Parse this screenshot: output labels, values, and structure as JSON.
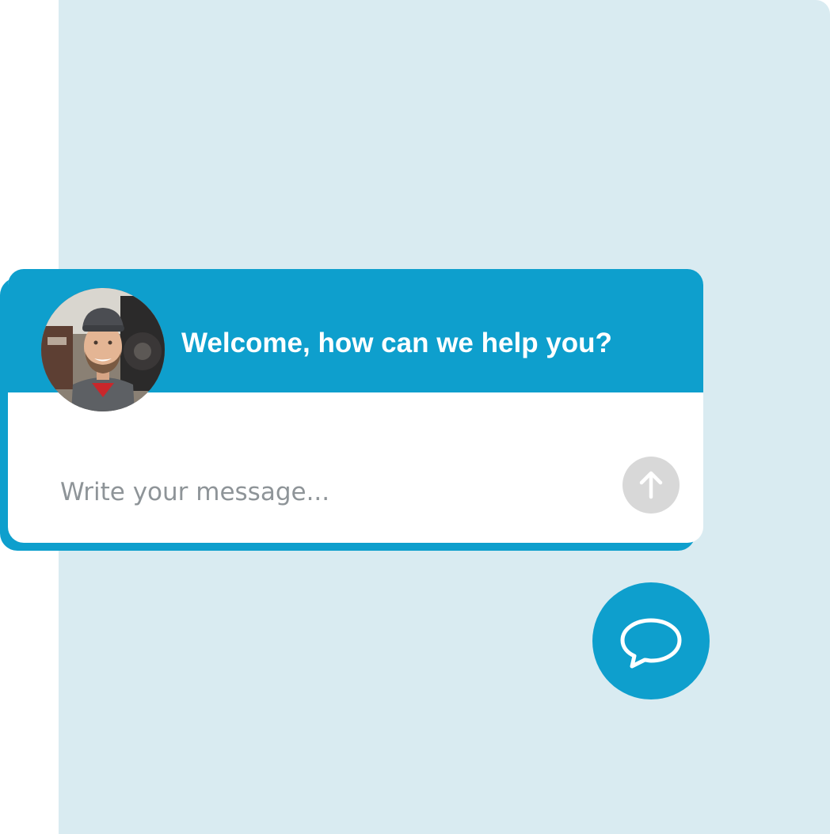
{
  "chat": {
    "title": "Welcome, how can we help you?",
    "input_placeholder": "Write your message...",
    "send_icon": "arrow-up-icon",
    "avatar_icon": "agent-avatar"
  },
  "launcher": {
    "icon": "speech-bubble-icon"
  },
  "colors": {
    "accent": "#0e9fcd",
    "backdrop": "#d9ebf1",
    "send_button": "#d8d8d8",
    "placeholder": "#8e9498"
  }
}
